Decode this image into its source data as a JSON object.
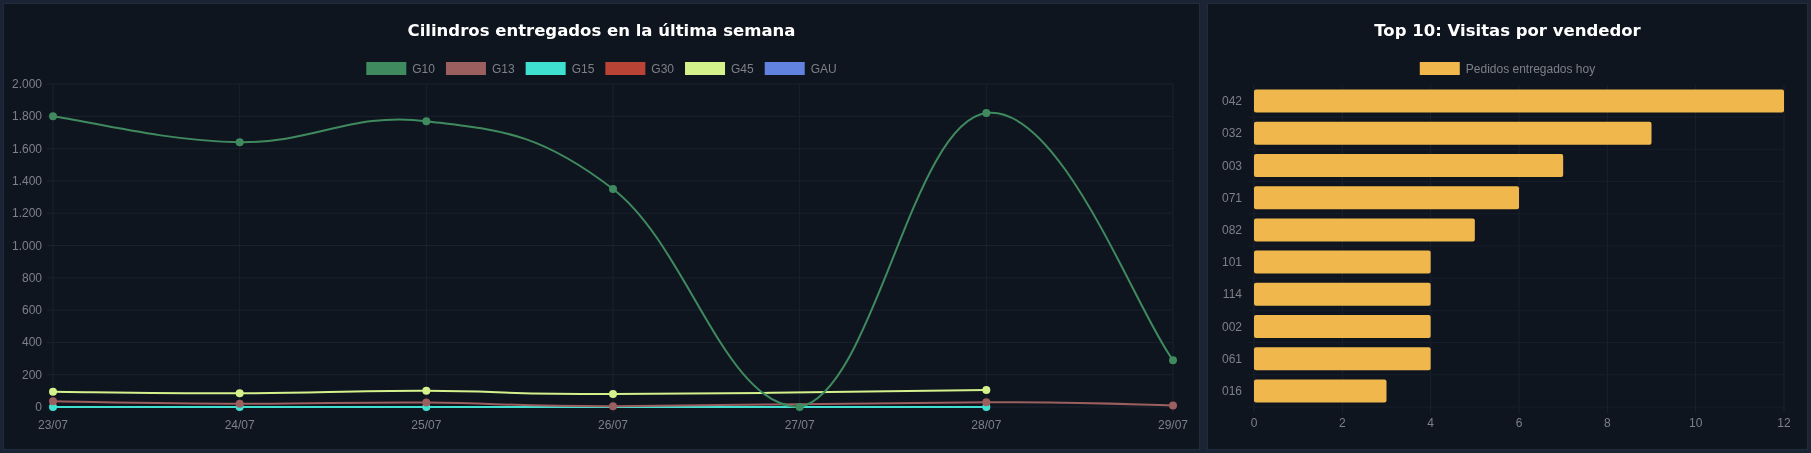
{
  "line_chart": {
    "chart_data": {
      "type": "line",
      "title": "Cilindros entregados en la última semana",
      "legend": "top",
      "grid": true,
      "categories": [
        "23/07",
        "24/07",
        "25/07",
        "26/07",
        "27/07",
        "28/07",
        "29/07"
      ],
      "series": [
        {
          "name": "G10",
          "color": "#3f8a5e",
          "marker": "circle",
          "values": [
            1800,
            1640,
            1770,
            1350,
            0,
            1820,
            290
          ]
        },
        {
          "name": "G13",
          "color": "#9a5f5e",
          "marker": "circle",
          "values": [
            35,
            20,
            28,
            5,
            null,
            30,
            10
          ]
        },
        {
          "name": "G15",
          "color": "#40e0d0",
          "marker": "circle",
          "values": [
            0,
            0,
            0,
            null,
            null,
            0,
            null
          ]
        },
        {
          "name": "G30",
          "color": "#b94435",
          "marker": "circle",
          "values": [
            null,
            null,
            null,
            null,
            null,
            null,
            null
          ]
        },
        {
          "name": "G45",
          "color": "#d4f28c",
          "marker": "circle",
          "values": [
            95,
            85,
            100,
            80,
            null,
            105,
            null
          ]
        },
        {
          "name": "GAU",
          "color": "#6282e0",
          "marker": "circle",
          "values": [
            null,
            null,
            null,
            null,
            null,
            null,
            null
          ]
        }
      ],
      "ylim": [
        0,
        2000
      ],
      "yticks": [
        {
          "value": 0,
          "label": "0"
        },
        {
          "value": 200,
          "label": "200"
        },
        {
          "value": 400,
          "label": "400"
        },
        {
          "value": 600,
          "label": "600"
        },
        {
          "value": 800,
          "label": "800"
        },
        {
          "value": 1000,
          "label": "1.000"
        },
        {
          "value": 1200,
          "label": "1.200"
        },
        {
          "value": 1400,
          "label": "1.400"
        },
        {
          "value": 1600,
          "label": "1.600"
        },
        {
          "value": 1800,
          "label": "1.800"
        },
        {
          "value": 2000,
          "label": "2.000"
        }
      ]
    }
  },
  "bar_chart": {
    "chart_data": {
      "type": "bar",
      "orientation": "horizontal",
      "title": "Top 10: Visitas por vendedor",
      "legend": "top",
      "grid": true,
      "categories": [
        "042",
        "032",
        "003",
        "071",
        "082",
        "101",
        "114",
        "002",
        "061",
        "016"
      ],
      "series": [
        {
          "name": "Pedidos entregados hoy",
          "color": "#f0b84c",
          "values": [
            12,
            9,
            7,
            6,
            5,
            4,
            4,
            4,
            4,
            3
          ]
        }
      ],
      "xlim": [
        0,
        12
      ],
      "xticks": [
        0,
        2,
        4,
        6,
        8,
        10,
        12
      ]
    }
  }
}
